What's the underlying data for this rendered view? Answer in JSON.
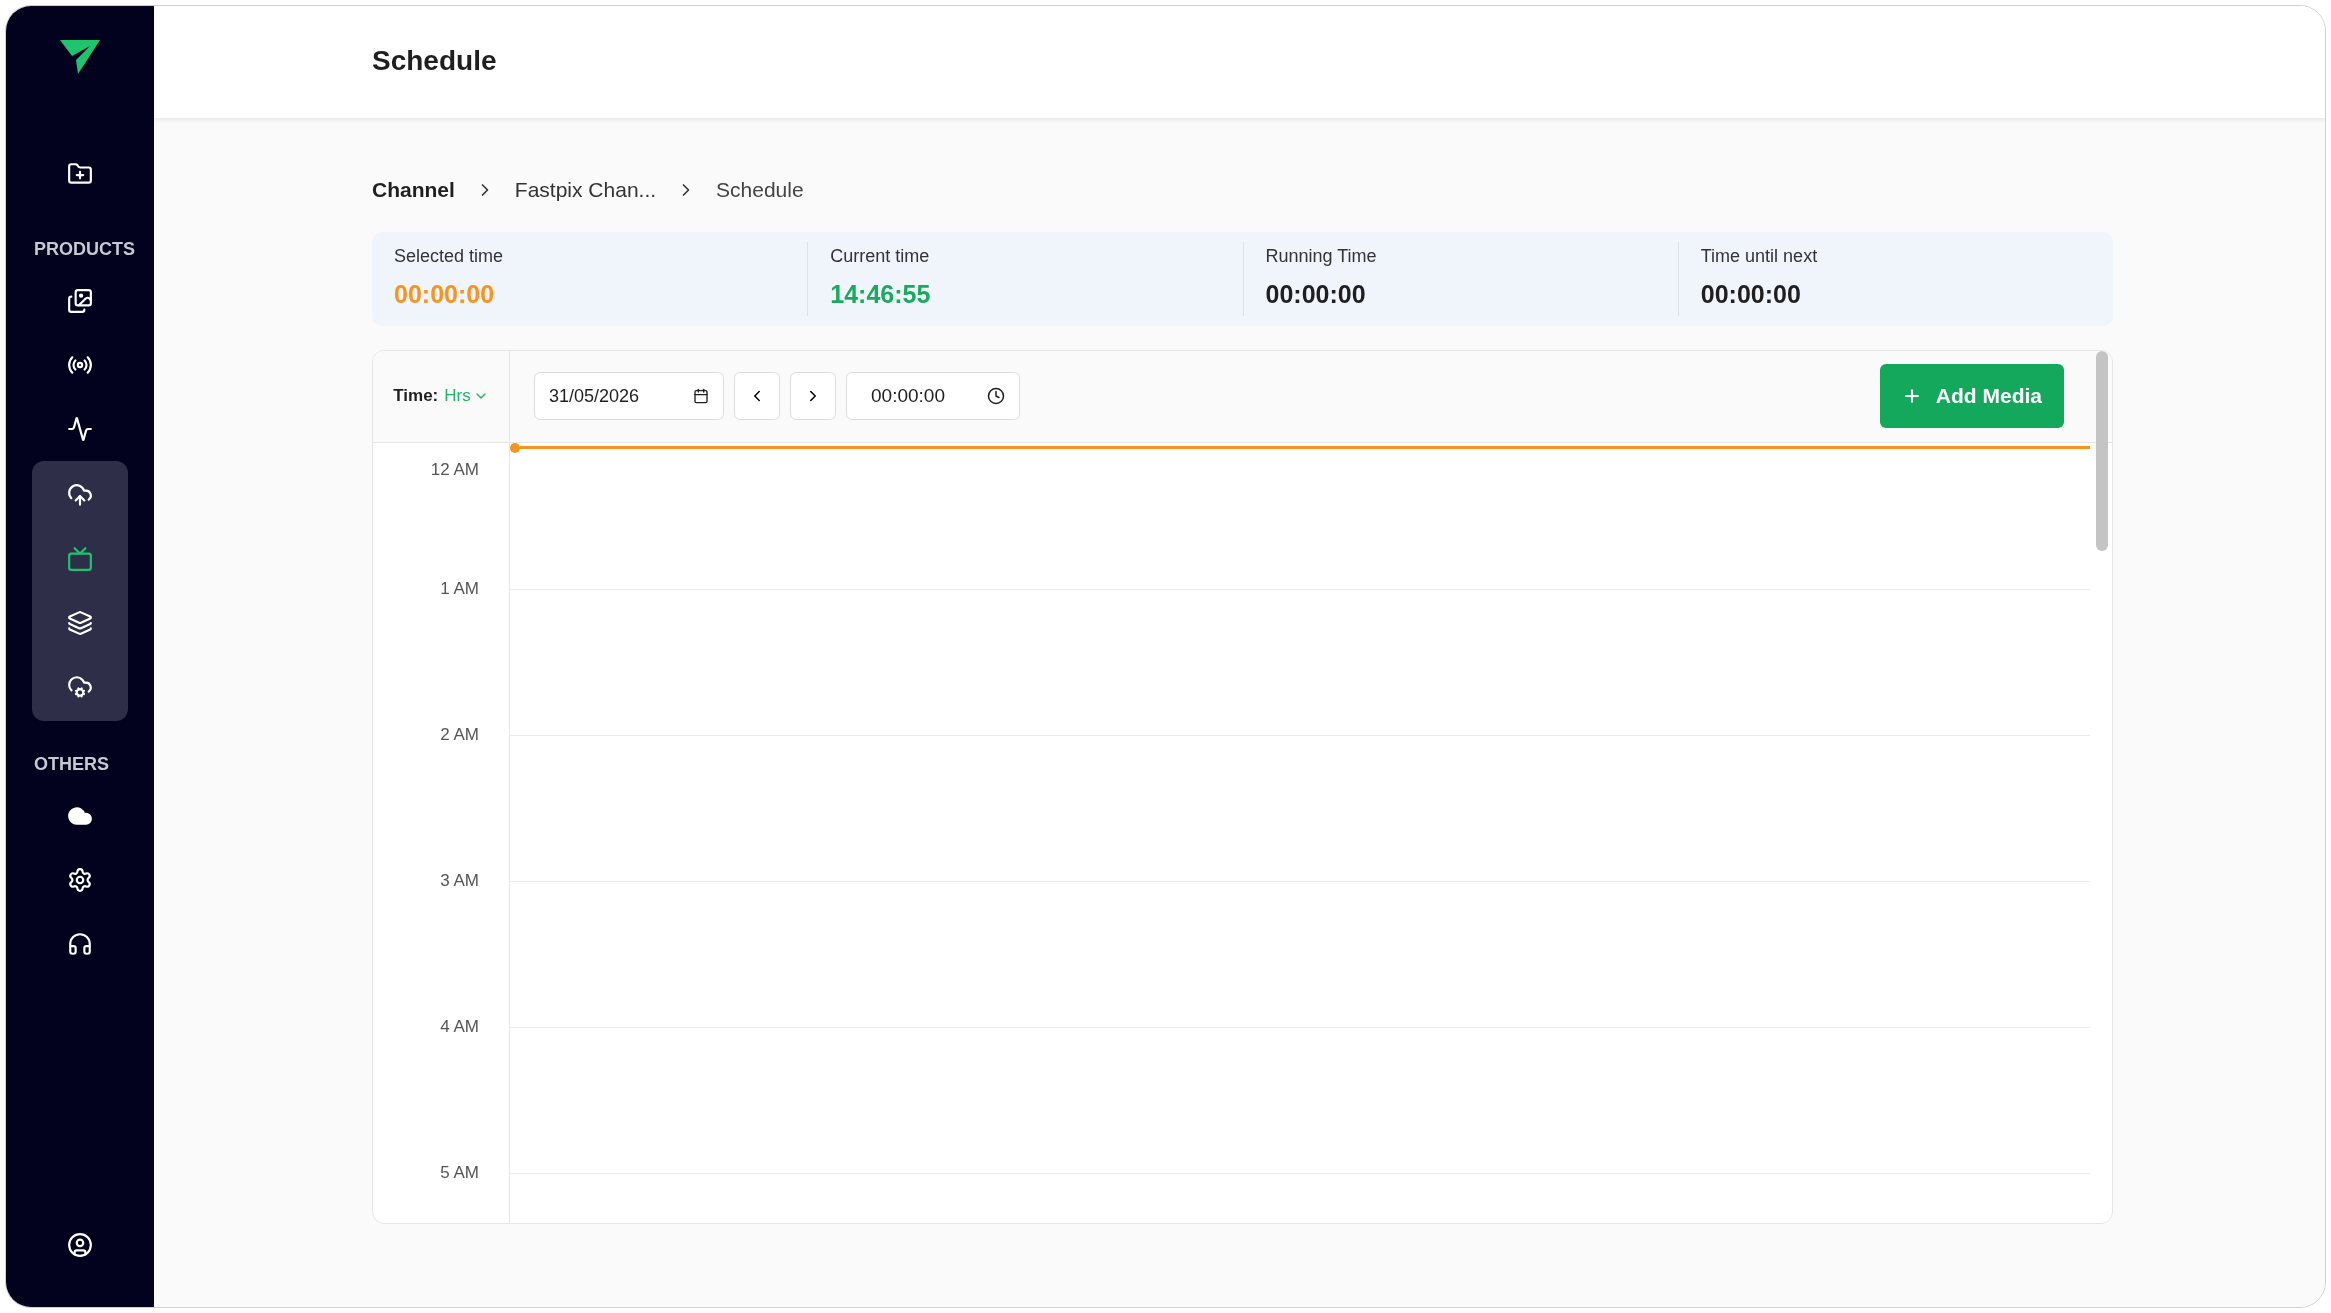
{
  "sidebar": {
    "top_items": [
      {
        "selected": false
      }
    ],
    "sections": [
      {
        "label": "PRODUCTS",
        "items": [
          {
            "selected": false
          },
          {
            "selected": false
          },
          {
            "selected": false
          },
          {
            "selected": false,
            "expanded": true,
            "children": [
              {
                "selected": true
              },
              {
                "selected": false
              },
              {
                "selected": false
              }
            ]
          }
        ]
      },
      {
        "label": "OTHERS",
        "items": [
          {
            "selected": false
          },
          {
            "selected": false
          },
          {
            "selected": false
          }
        ]
      }
    ],
    "bottom_items": [
      {
        "selected": false
      }
    ]
  },
  "header": {
    "title": "Schedule"
  },
  "breadcrumb": [
    {
      "label": "Channel",
      "current": false,
      "bold": true
    },
    {
      "label": "Fastpix Chan...",
      "current": false,
      "bold": false
    },
    {
      "label": "Schedule",
      "current": true,
      "bold": false
    }
  ],
  "stats": [
    {
      "label": "Selected time",
      "value": "00:00:00",
      "color": "#f7931e"
    },
    {
      "label": "Current time",
      "value": "14:46:55",
      "color": "#1aaa5e"
    },
    {
      "label": "Running Time",
      "value": "00:00:00",
      "color": "#1f1f1f"
    },
    {
      "label": "Time until next",
      "value": "00:00:00",
      "color": "#1f1f1f"
    }
  ],
  "toolbar": {
    "time_label": "Time:",
    "time_unit": "Hrs",
    "date": "31/05/2026",
    "time": "00:00:00",
    "add_button": "Add Media"
  },
  "timeline": {
    "hours": [
      "12 AM",
      "1 AM",
      "2 AM",
      "3 AM",
      "4 AM",
      "5 AM"
    ]
  }
}
